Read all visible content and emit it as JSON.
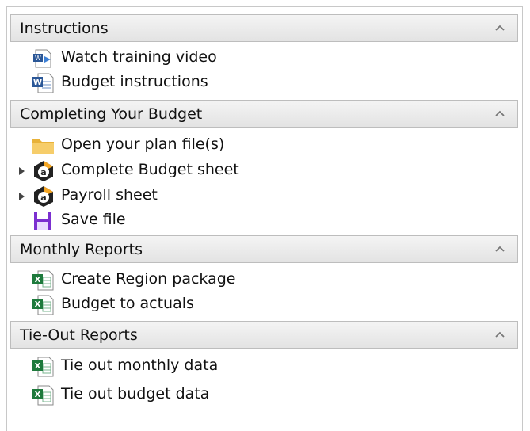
{
  "sections": [
    {
      "title": "Instructions",
      "items": [
        {
          "label": "Watch training video",
          "icon": "video-doc-icon"
        },
        {
          "label": "Budget instructions",
          "icon": "word-doc-icon"
        }
      ]
    },
    {
      "title": "Completing Your Budget",
      "items": [
        {
          "label": "Open your plan file(s)",
          "icon": "folder-icon"
        },
        {
          "label": "Complete Budget sheet",
          "icon": "app-badge-icon"
        },
        {
          "label": "Payroll sheet",
          "icon": "app-badge-icon"
        },
        {
          "label": "Save file",
          "icon": "save-disk-icon"
        }
      ]
    },
    {
      "title": "Monthly Reports",
      "items": [
        {
          "label": "Create Region package",
          "icon": "excel-doc-icon"
        },
        {
          "label": "Budget to actuals",
          "icon": "excel-doc-icon"
        }
      ]
    },
    {
      "title": "Tie-Out Reports",
      "items": [
        {
          "label": "Tie out monthly data",
          "icon": "excel-doc-icon"
        },
        {
          "label": "Tie out budget data",
          "icon": "excel-doc-icon"
        }
      ]
    }
  ],
  "colors": {
    "header_bg": "#e8e8e8",
    "border": "#bdbdbd",
    "excel_green": "#1e7a3c",
    "word_blue": "#2b5797",
    "folder_yellow": "#f2c14e",
    "save_purple": "#7b2fd0"
  }
}
